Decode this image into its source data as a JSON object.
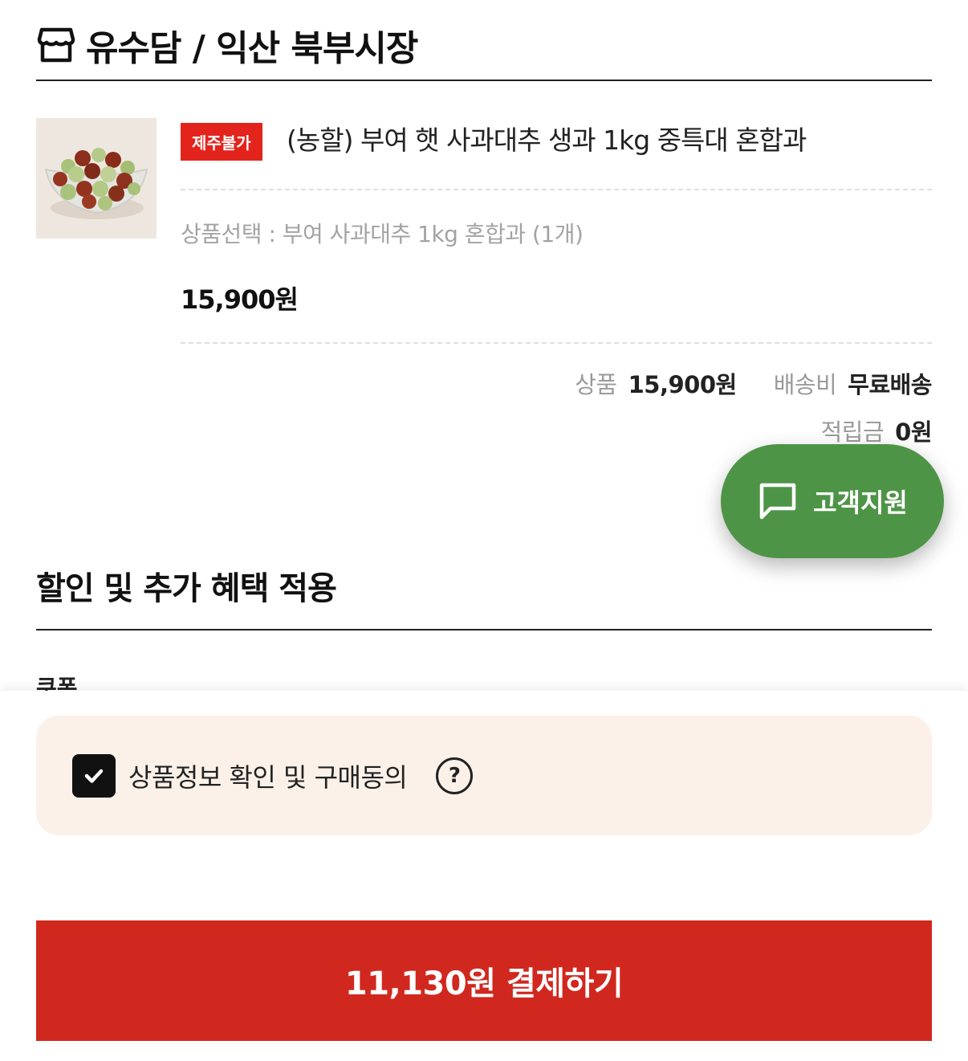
{
  "store": {
    "icon": "storefront-icon",
    "title": "유수담 / 익산 북부시장"
  },
  "product": {
    "badge": "제주불가",
    "name": "(농할) 부여 햇 사과대추 생과 1kg 중특대 혼합과",
    "option": "상품선택 : 부여 사과대추 1kg 혼합과 (1개)",
    "price": "15,900원",
    "thumbnail": "jujube-bowl-image"
  },
  "summary": {
    "product_label": "상품",
    "product_value": "15,900원",
    "shipping_label": "배송비",
    "shipping_value": "무료배송",
    "points_label": "적립금",
    "points_value": "0원"
  },
  "support": {
    "label": "고객지원",
    "icon": "chat-bubble-icon",
    "color": "#4e9447"
  },
  "discount": {
    "title": "할인 및 추가 혜택 적용",
    "coupon_label": "쿠폰"
  },
  "agreement": {
    "label": "상품정보 확인 및 구매동의",
    "checked": true,
    "help_icon": "question-circle-icon",
    "help_glyph": "?"
  },
  "payment": {
    "button_label": "11,130원 결제하기",
    "color": "#d0281f"
  },
  "colors": {
    "badge": "#e2241d",
    "agree_background": "#fbf1e9"
  }
}
